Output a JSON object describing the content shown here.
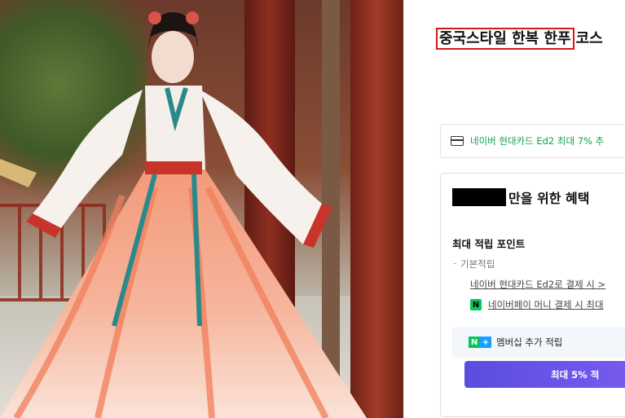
{
  "product": {
    "title_highlight": "중국스타일 한복 한푸",
    "title_rest": "코스"
  },
  "card_notice": {
    "icon": "credit-card-icon",
    "text": "네이버 현대카드 Ed2 최대 7% 추"
  },
  "benefit": {
    "title": "만을 위한 혜택",
    "points_title": "최대 적립 포인트",
    "base_label": "기본적립",
    "card_link": "네이버 현대카드 Ed2로 결제 시 >",
    "npay_icon": "N",
    "npay_link": "네이버페이 머니 결제 시 최대",
    "member_icons": [
      "N",
      "+"
    ],
    "member_text": "멤버십 추가 적립",
    "promo_button": "최대 5% 적"
  },
  "colors": {
    "highlight_border": "#d21a1a",
    "notice_green": "#0fa34a",
    "naver_green": "#03c75a",
    "button_purple": "#6a55e8"
  }
}
